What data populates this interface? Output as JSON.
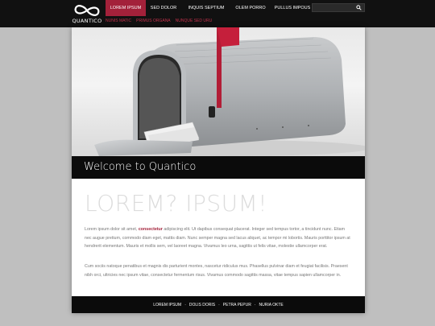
{
  "brand": {
    "name": "QUANTICO"
  },
  "nav": {
    "items": [
      {
        "label": "LOREM IPSUM",
        "active": true
      },
      {
        "label": "SED DOLOR",
        "active": false
      },
      {
        "label": "INQUIS SEPTIUM",
        "active": false
      },
      {
        "label": "OLEM PORRO",
        "active": false
      },
      {
        "label": "PULLUS IMPOUS",
        "active": false
      }
    ],
    "subitems": [
      "NUNIS MATIC",
      "PRIMUS ORGANA",
      "NUNQUE SED URU"
    ]
  },
  "search": {
    "placeholder": "",
    "icon": "search-icon"
  },
  "hero": {
    "image": "mailbox with red flag raised, letters inside"
  },
  "welcome": {
    "title": "Welcome to Quantico"
  },
  "content": {
    "headline": "LOREM? IPSUM!",
    "para1_before": "Lorem ipsum dolor sit amet, ",
    "para1_strong": "consectetur",
    "para1_after": " adipiscing elit. Ut dapibus consequat placerat. Integer sed tempus tortor, a tincidunt nunc. Etiam nec augue pretium, commodo diam eget, mattis diam. Nunc semper magna sed lacus aliquet, ac tempor mi lobortis. Mauris porttitor ipsum at hendrerit elementum. Mauris et mollis sem, vel laoreet magna. Vivamus leo urna, sagittis ut felis vitae, molestie ullamcorper erat.",
    "para2": "Cum sociis natoque penatibus et magnis dis parturient montes, nascetur ridiculus mus. Phasellus pulvinar diam et feugiat facilisis. Praesent nibh orci, ultricies nec ipsum vitae, consectetur fermentum risus. Vivamus commodo sagittis massa, vitae tempus sapien ullamcorper in."
  },
  "footer": {
    "links": [
      "LOREM IPSUM",
      "DOLIS DORIS",
      "PETRA PEPUR",
      "NURIA OKTE"
    ],
    "separator": "·"
  },
  "colors": {
    "accent": "#a3213a",
    "bar": "#111111",
    "background": "#bfbfbf"
  }
}
